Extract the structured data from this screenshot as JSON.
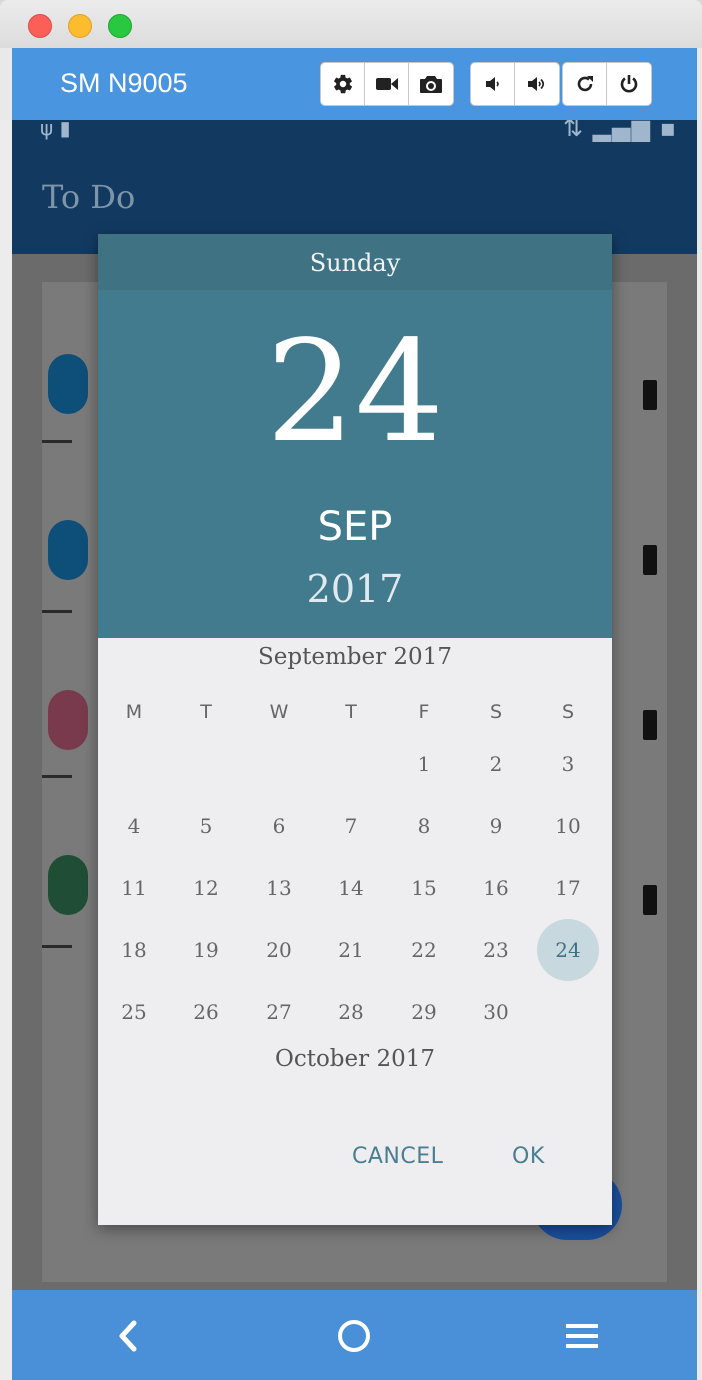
{
  "window": {
    "device_name": "SM N9005",
    "toolbar": {
      "icons": [
        "gear-icon",
        "video-camera-icon",
        "camera-icon",
        "volume-down-icon",
        "volume-up-icon",
        "rotate-icon",
        "power-icon"
      ]
    }
  },
  "app": {
    "title": "To Do"
  },
  "dialog": {
    "weekday": "Sunday",
    "day": "24",
    "month": "SEP",
    "year": "2017",
    "calendar_title": "September 2017",
    "next_month_title": "October 2017",
    "weekdays": [
      "M",
      "T",
      "W",
      "T",
      "F",
      "S",
      "S"
    ],
    "weeks": [
      [
        "",
        "",
        "",
        "",
        "1",
        "2",
        "3"
      ],
      [
        "4",
        "5",
        "6",
        "7",
        "8",
        "9",
        "10"
      ],
      [
        "11",
        "12",
        "13",
        "14",
        "15",
        "16",
        "17"
      ],
      [
        "18",
        "19",
        "20",
        "21",
        "22",
        "23",
        "24"
      ],
      [
        "25",
        "26",
        "27",
        "28",
        "29",
        "30",
        ""
      ]
    ],
    "selected_day": "24",
    "cancel_label": "CANCEL",
    "ok_label": "OK"
  },
  "navbar": {
    "icons": [
      "back-icon",
      "home-icon",
      "menu-icon"
    ]
  },
  "colors": {
    "device_toolbar": "#4a95e0",
    "dialog_header": "#427b8e",
    "selected_circle": "#c7d8df",
    "button_text": "#4a7f92"
  }
}
